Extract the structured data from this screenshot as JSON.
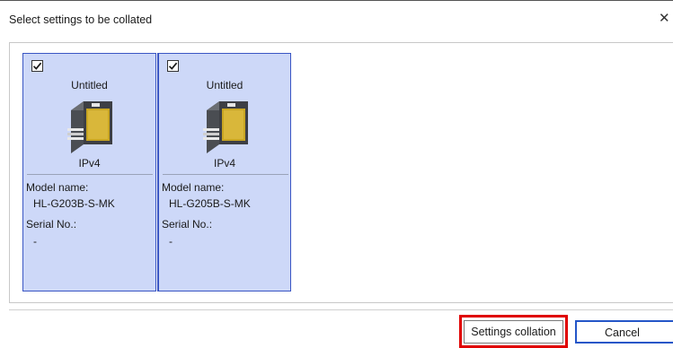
{
  "dialog": {
    "title": "Select settings to be collated",
    "close_glyph": "✕",
    "close_icon": "close-icon"
  },
  "devices": [
    {
      "checked": true,
      "name": "Untitled",
      "protocol": "IPv4",
      "model_label": "Model name:",
      "model_value": "HL-G203B-S-MK",
      "serial_label": "Serial No.:",
      "serial_value": "-",
      "icon": "sensor-device-icon"
    },
    {
      "checked": true,
      "name": "Untitled",
      "protocol": "IPv4",
      "model_label": "Model name:",
      "model_value": "HL-G205B-S-MK",
      "serial_label": "Serial No.:",
      "serial_value": "-",
      "icon": "sensor-device-icon"
    }
  ],
  "buttons": {
    "collate_label": "Settings collation",
    "cancel_label": "Cancel"
  },
  "colors": {
    "card_bg": "#cdd8f8",
    "card_border": "#3a56c4",
    "highlight": "#e00000",
    "cancel_border": "#2456c8"
  }
}
